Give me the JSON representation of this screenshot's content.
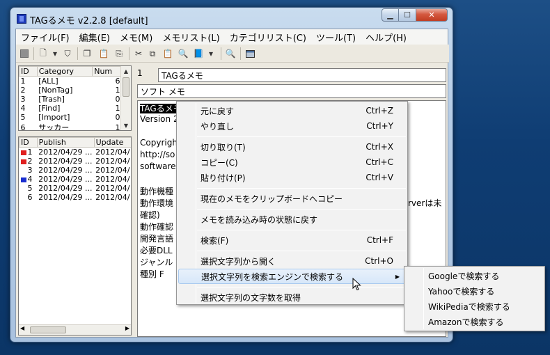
{
  "window": {
    "title": "TAGるメモ v2.2.8 [default]"
  },
  "menu": [
    "ファイル(F)",
    "編集(E)",
    "メモ(M)",
    "メモリスト(L)",
    "カテゴリリスト(C)",
    "ツール(T)",
    "ヘルプ(H)"
  ],
  "category_list": {
    "headers": [
      "ID",
      "Category",
      "Num"
    ],
    "rows": [
      {
        "id": "1",
        "name": "[ALL]",
        "num": "6"
      },
      {
        "id": "2",
        "name": "[NonTag]",
        "num": "1"
      },
      {
        "id": "3",
        "name": "[Trash]",
        "num": "0"
      },
      {
        "id": "4",
        "name": "[Find]",
        "num": "1"
      },
      {
        "id": "5",
        "name": "[Import]",
        "num": "0"
      },
      {
        "id": "6",
        "name": "サッカー",
        "num": "1"
      }
    ]
  },
  "memo_list": {
    "headers": [
      "ID",
      "Publish",
      "Update"
    ],
    "rows": [
      {
        "id": "1",
        "publish": "2012/04/29 ...",
        "update": "2012/04/",
        "flag": "red"
      },
      {
        "id": "2",
        "publish": "2012/04/29 ...",
        "update": "2012/04/",
        "flag": "red"
      },
      {
        "id": "3",
        "publish": "2012/04/29 ...",
        "update": "2012/04/",
        "flag": ""
      },
      {
        "id": "4",
        "publish": "2012/04/29 ...",
        "update": "2012/04/",
        "flag": "blue"
      },
      {
        "id": "5",
        "publish": "2012/04/29 ...",
        "update": "2012/04/",
        "flag": ""
      },
      {
        "id": "6",
        "publish": "2012/04/29 ...",
        "update": "2012/04/",
        "flag": ""
      }
    ]
  },
  "editor": {
    "memo_id": "1",
    "title": "TAGるメモ",
    "tags": "ソフト メモ",
    "lines": [
      "TAGるメモ",
      "Version 2",
      "",
      "Copyright",
      "http://so",
      "software@",
      "",
      "動作機種",
      "動作環境",
      "確認)",
      "動作確認",
      "開発言語",
      "必要DLL",
      "ジャンル ",
      "種別     F"
    ],
    "overflow_text": "rverは未"
  },
  "context_menu": {
    "items": [
      {
        "label": "元に戻す",
        "shortcut": "Ctrl+Z"
      },
      {
        "label": "やり直し",
        "shortcut": "Ctrl+Y"
      },
      {
        "label": "切り取り(T)",
        "shortcut": "Ctrl+X"
      },
      {
        "label": "コピー(C)",
        "shortcut": "Ctrl+C"
      },
      {
        "label": "貼り付け(P)",
        "shortcut": "Ctrl+V"
      },
      {
        "label": "現在のメモをクリップボードへコピー",
        "shortcut": ""
      },
      {
        "label": "メモを読み込み時の状態に戻す",
        "shortcut": ""
      },
      {
        "label": "検索(F)",
        "shortcut": "Ctrl+F"
      },
      {
        "label": "選択文字列から開く",
        "shortcut": "Ctrl+O"
      },
      {
        "label": "選択文字列を検索エンジンで検索する",
        "shortcut": ""
      },
      {
        "label": "選択文字列の文字数を取得",
        "shortcut": ""
      }
    ]
  },
  "submenu": {
    "items": [
      "Googleで検索する",
      "Yahooで検索する",
      "WikiPediaで検索する",
      "Amazonで検索する"
    ]
  },
  "colors": {
    "flag_red": "#e02020",
    "flag_blue": "#1a2fd0",
    "highlight": "#d7e7f9"
  }
}
